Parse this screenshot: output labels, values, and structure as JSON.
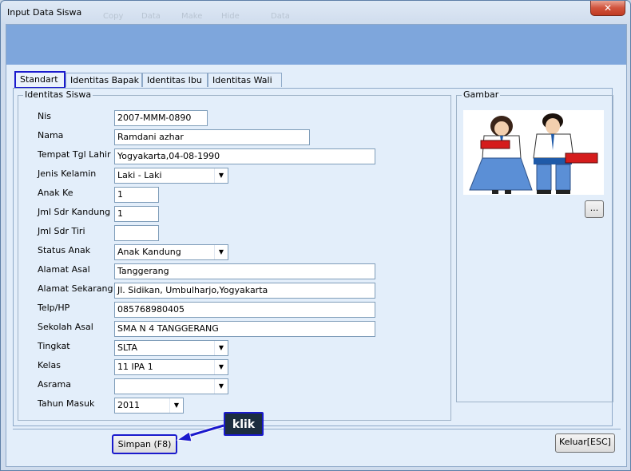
{
  "window": {
    "title": "Input Data Siswa",
    "close_glyph": "✕",
    "ghost_labels": [
      "Copy",
      "Data",
      "Make",
      "Hide",
      "Data"
    ]
  },
  "tabs": [
    {
      "label": "Standart",
      "active": true
    },
    {
      "label": "Identitas Bapak",
      "active": false
    },
    {
      "label": "Identitas Ibu",
      "active": false
    },
    {
      "label": "Identitas Wali",
      "active": false
    }
  ],
  "identitas": {
    "legend": "Identitas Siswa",
    "fields": {
      "nis": {
        "label": "Nis",
        "value": "2007-MMM-0890"
      },
      "nama": {
        "label": "Nama",
        "value": "Ramdani azhar"
      },
      "ttl": {
        "label": "Tempat Tgl Lahir",
        "value": "Yogyakarta,04-08-1990"
      },
      "jk": {
        "label": "Jenis Kelamin",
        "value": "Laki - Laki"
      },
      "anak_ke": {
        "label": "Anak Ke",
        "value": "1"
      },
      "jml_kandung": {
        "label": "Jml Sdr Kandung",
        "value": "1"
      },
      "jml_tiri": {
        "label": "Jml Sdr Tiri",
        "value": ""
      },
      "status": {
        "label": "Status Anak",
        "value": "Anak Kandung"
      },
      "alamat_asal": {
        "label": "Alamat Asal",
        "value": "Tanggerang"
      },
      "alamat_skr": {
        "label": "Alamat Sekarang",
        "value": "Jl. Sidikan, Umbulharjo,Yogyakarta"
      },
      "telp": {
        "label": "Telp/HP",
        "value": "085768980405"
      },
      "sekolah": {
        "label": "Sekolah Asal",
        "value": "SMA N 4 TANGGERANG"
      },
      "tingkat": {
        "label": "Tingkat",
        "value": "SLTA"
      },
      "kelas": {
        "label": "Kelas",
        "value": "11 IPA 1"
      },
      "asrama": {
        "label": "Asrama",
        "value": ""
      },
      "tahun": {
        "label": "Tahun Masuk",
        "value": "2011"
      }
    }
  },
  "gambar": {
    "legend": "Gambar",
    "browse_label": "...",
    "photo_icon": "student-couple-illustration"
  },
  "buttons": {
    "simpan": "Simpan (F8)",
    "keluar": "Keluar[ESC]"
  },
  "callout": {
    "text": "klik"
  },
  "colors": {
    "highlight": "#1a1acd",
    "banner": "#7ea6dc",
    "callout_bg": "#1c2d3f"
  }
}
